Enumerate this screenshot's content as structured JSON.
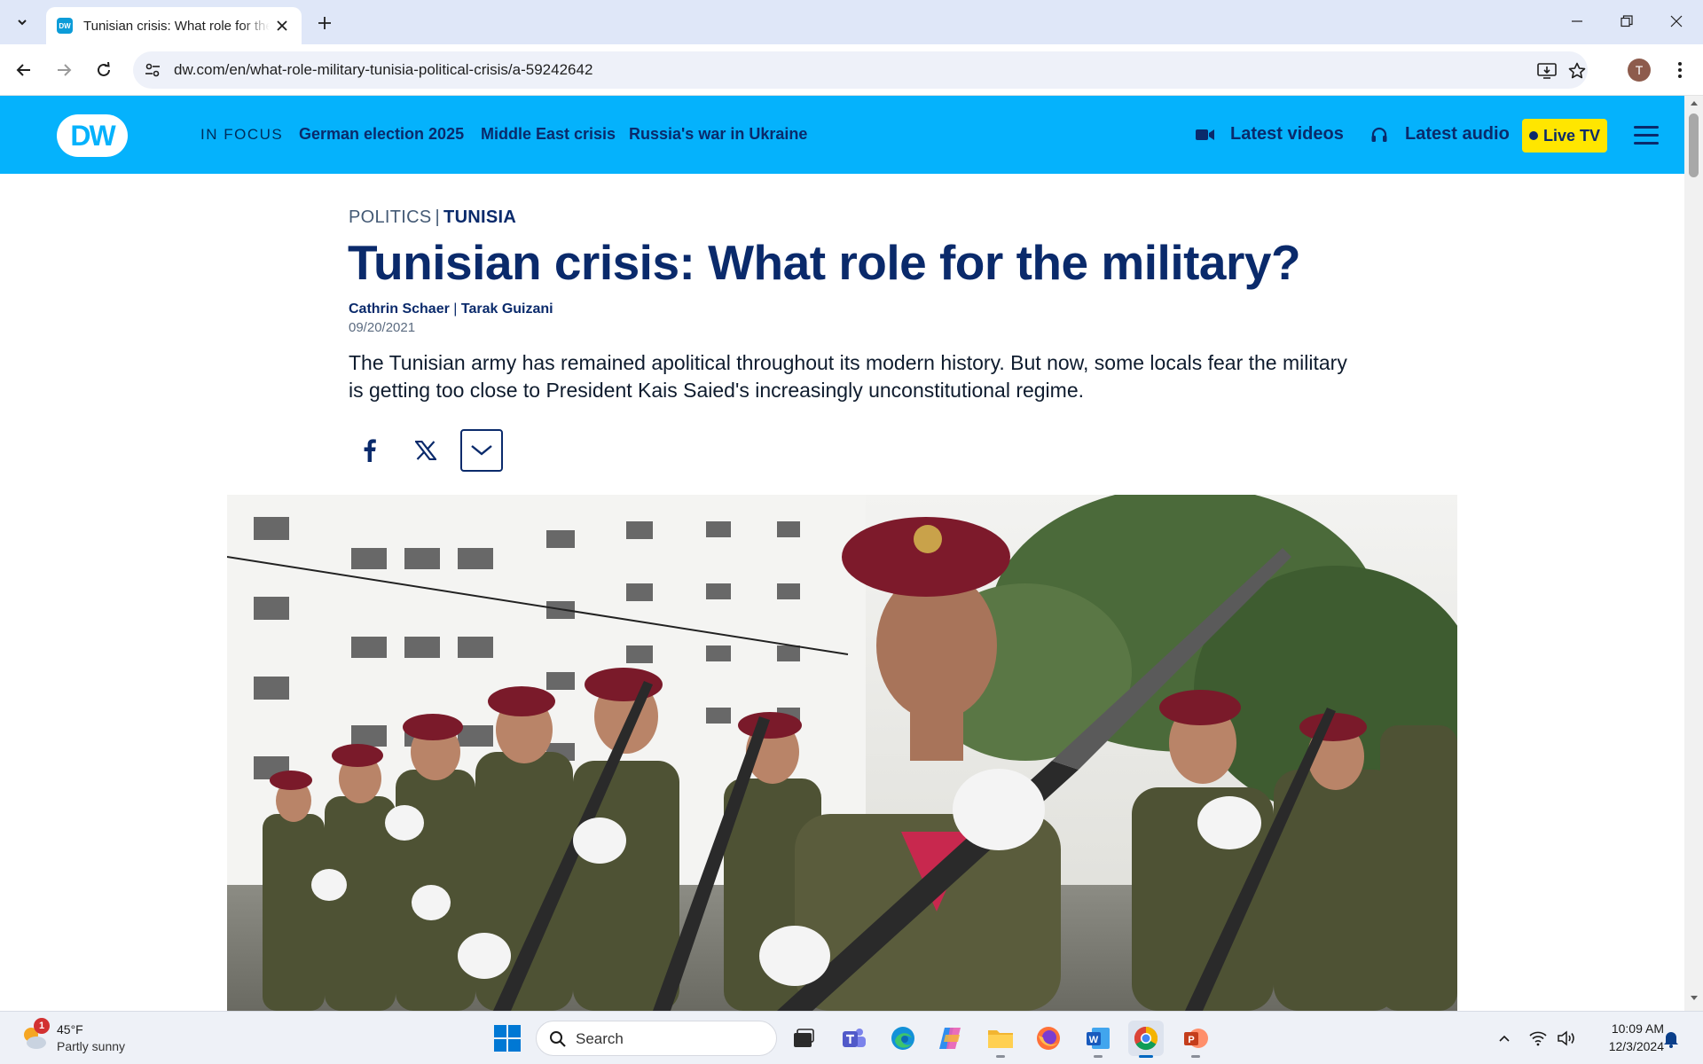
{
  "browser": {
    "tab_title": "Tunisian crisis: What role for the military?",
    "url": "dw.com/en/what-role-military-tunisia-political-crisis/a-59242642",
    "profile_initial": "T"
  },
  "site": {
    "logo_text": "DW",
    "in_focus_label": "IN FOCUS",
    "focus_links": [
      "German election 2025",
      "Middle East crisis",
      "Russia's war in Ukraine"
    ],
    "latest_videos": "Latest videos",
    "latest_audio": "Latest audio",
    "live_tv": "Live TV",
    "brand_color": "#05b2fc",
    "accent_color": "#0a2a6b",
    "live_color": "#ffe600"
  },
  "article": {
    "category": "POLITICS",
    "country": "TUNISIA",
    "headline": "Tunisian crisis: What role for the military?",
    "author_1": "Cathrin Schaer",
    "author_2": "Tarak Guizani",
    "date": "09/20/2021",
    "teaser": "The Tunisian army has remained apolitical throughout its modern history. But now, some locals fear the military is getting too close to President Kais Saied's increasingly unconstitutional regime.",
    "share_icons": [
      "facebook-icon",
      "x-icon",
      "chevron-down-icon"
    ]
  },
  "taskbar": {
    "weather_temp": "45°F",
    "weather_desc": "Partly sunny",
    "weather_badge": "1",
    "search_placeholder": "Search",
    "time": "10:09 AM",
    "date": "12/3/2024",
    "apps": [
      "task-view",
      "teams",
      "edge",
      "copilot",
      "file-explorer",
      "firefox",
      "word",
      "chrome",
      "powerpoint"
    ]
  }
}
